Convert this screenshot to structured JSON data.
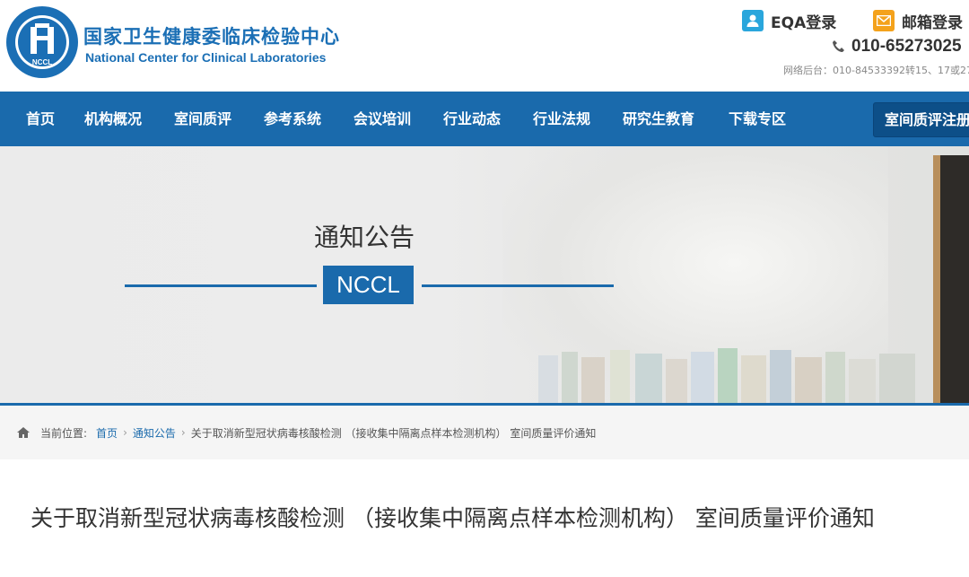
{
  "header": {
    "cn_title": "国家卫生健康委临床检验中心",
    "en_title": "National Center for Clinical Laboratories",
    "logo_text": "NCCL",
    "logo_ring_text": "国家卫生健康委临床检验中心 National Center for Clinical Laboratories",
    "eqa_login": "EQA登录",
    "mail_login": "邮箱登录",
    "phone": "010-65273025",
    "network_note": "网络后台：010-84533392转15、17或27",
    "colors": {
      "brand": "#1b6fb5",
      "eqa_icon": "#2aa6dc",
      "mail_icon": "#f4a21c"
    }
  },
  "nav": {
    "items": [
      "首页",
      "机构概况",
      "室间质评",
      "参考系统",
      "会议培训",
      "行业动态",
      "行业法规",
      "研究生教育",
      "下载专区"
    ],
    "register_button": "室间质评注册"
  },
  "banner": {
    "title": "通知公告",
    "badge": "NCCL"
  },
  "breadcrumb": {
    "label": "当前位置:",
    "home": "首页",
    "section": "通知公告",
    "current": "关于取消新型冠状病毒核酸检测 （接收集中隔离点样本检测机构） 室间质量评价通知"
  },
  "article": {
    "title": "关于取消新型冠状病毒核酸检测 （接收集中隔离点样本检测机构） 室间质量评价通知"
  }
}
